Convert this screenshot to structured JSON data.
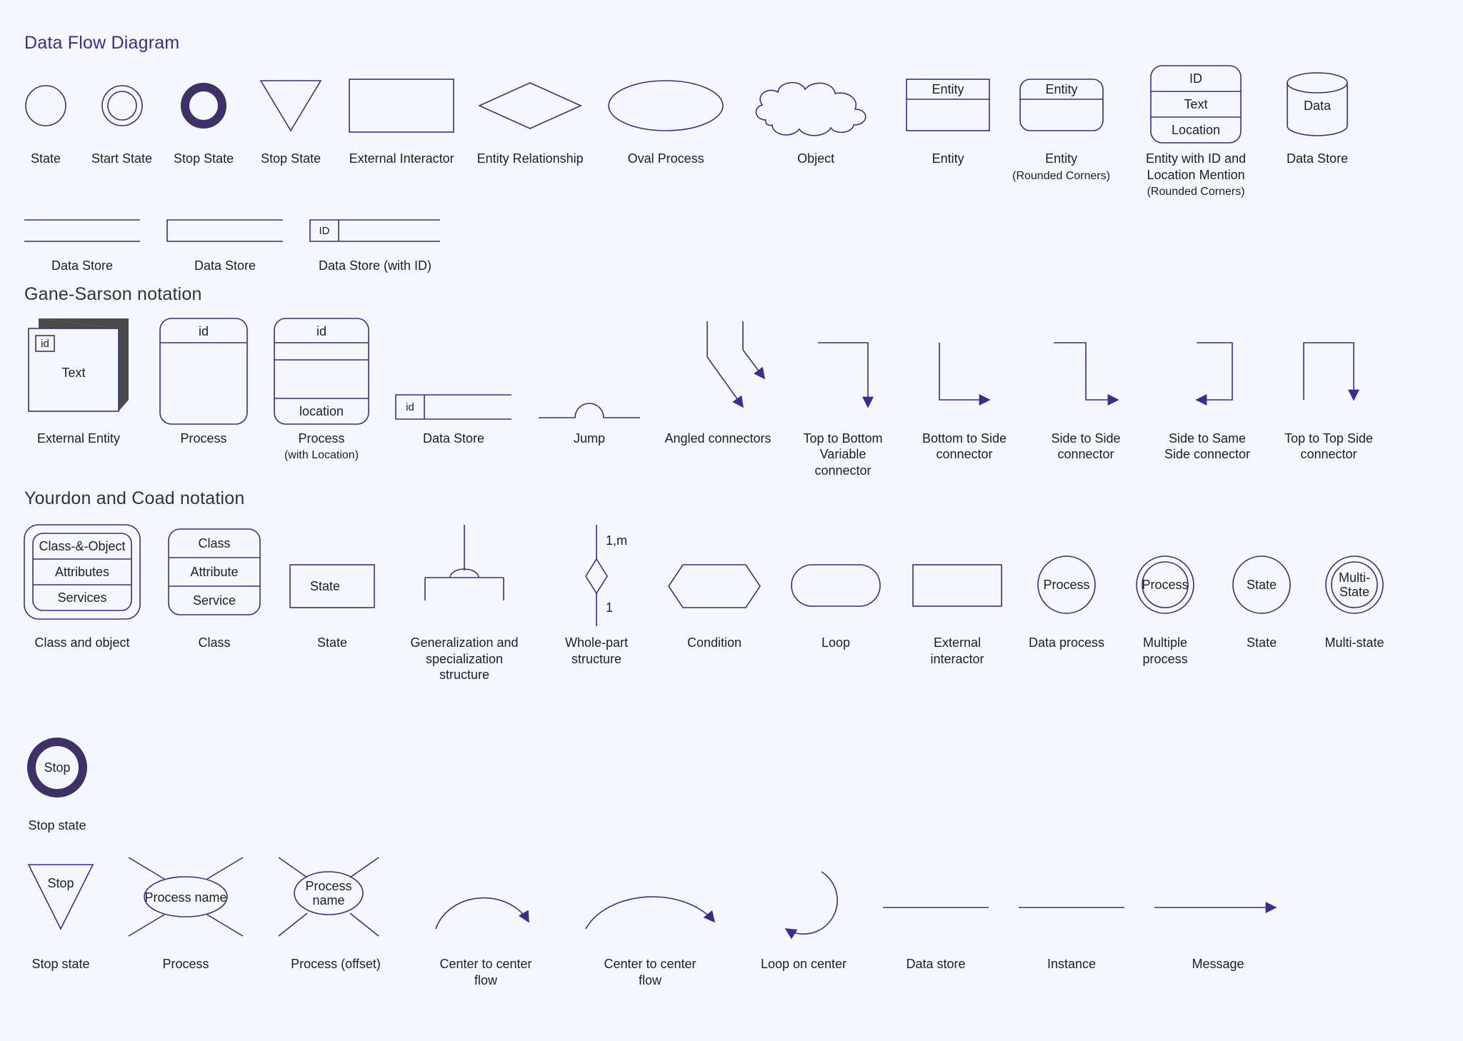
{
  "section1": {
    "title": "Data Flow Diagram",
    "items": {
      "state": "State",
      "start_state": "Start State",
      "stop_state": "Stop State",
      "stop_state2": "Stop State",
      "ext_interactor": "External Interactor",
      "entity_rel": "Entity Relationship",
      "oval_process": "Oval Process",
      "object": "Object",
      "entity": "Entity",
      "entity_label": "Entity",
      "entity_round": "Entity",
      "entity_round_sub": "(Rounded Corners)",
      "entity_round_label": "Entity",
      "entity_idloc": "Entity with ID and Location Mention",
      "entity_idloc_sub": "(Rounded Corners)",
      "idloc_id": "ID",
      "idloc_text": "Text",
      "idloc_loc": "Location",
      "data_store": "Data Store",
      "data_store_cyl": "Data",
      "ds1": "Data Store",
      "ds2": "Data Store",
      "ds3": "Data Store (with ID)",
      "ds3_id": "ID"
    }
  },
  "section2": {
    "title": "Gane-Sarson notation",
    "items": {
      "ext_entity": "External Entity",
      "ext_entity_id": "id",
      "ext_entity_text": "Text",
      "process": "Process",
      "process_id": "id",
      "process_loc": "Process",
      "process_loc_sub": "(with Location)",
      "proc_id": "id",
      "proc_loc": "location",
      "ds": "Data Store",
      "ds_id": "id",
      "jump": "Jump",
      "angled": "Angled connectors",
      "top_bottom": "Top to Bottom Variable connector",
      "bottom_side": "Bottom to Side connector",
      "side_side": "Side to Side connector",
      "side_same": "Side to Same Side connector",
      "top_top": "Top to Top Side connector"
    }
  },
  "section3": {
    "title": "Yourdon and Coad notation",
    "items": {
      "class_obj": "Class and object",
      "co_title": "Class-&-Object",
      "co_attr": "Attributes",
      "co_serv": "Services",
      "class": "Class",
      "cl_title": "Class",
      "cl_attr": "Attribute",
      "cl_serv": "Service",
      "state": "State",
      "state_lbl": "State",
      "genspec": "Generalization and specialization structure",
      "wholepart": "Whole-part structure",
      "wp_top": "1,m",
      "wp_bot": "1",
      "condition": "Condition",
      "loop": "Loop",
      "ext_inter": "External interactor",
      "data_process": "Data process",
      "dp_lbl": "Process",
      "multi_process": "Multiple process",
      "mp_lbl": "Process",
      "state2": "State",
      "state2_lbl": "State",
      "multi_state": "Multi-state",
      "ms_lbl1": "Multi-",
      "ms_lbl2": "State",
      "stop_state": "Stop state",
      "stop_lbl": "Stop",
      "stop_state2": "Stop state",
      "stop2_lbl": "Stop",
      "process2": "Process",
      "proc2_lbl": "Process name",
      "process_offset": "Process (offset)",
      "po_lbl1": "Process",
      "po_lbl2": "name",
      "c2c1": "Center to center flow",
      "c2c2": "Center to center flow",
      "loop_center": "Loop on center",
      "data_store": "Data store",
      "instance": "Instance",
      "message": "Message"
    }
  }
}
